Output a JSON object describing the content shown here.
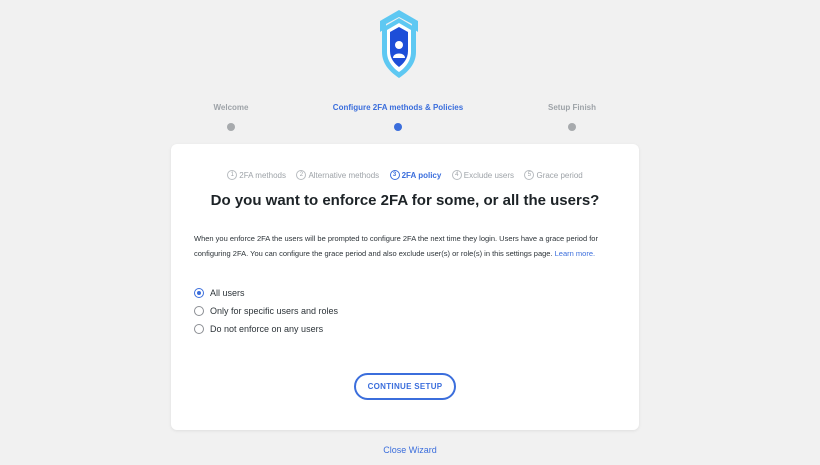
{
  "colors": {
    "accent": "#3b6edc",
    "muted": "#9ea3a8",
    "background": "#f1f1f1"
  },
  "logo": {
    "icon": "shield-lock-icon"
  },
  "stepper": [
    {
      "label": "Welcome",
      "active": false
    },
    {
      "label": "Configure 2FA methods & Policies",
      "active": true
    },
    {
      "label": "Setup Finish",
      "active": false
    }
  ],
  "substeps": [
    {
      "num": "1",
      "label": "2FA methods",
      "active": false
    },
    {
      "num": "2",
      "label": "Alternative methods",
      "active": false
    },
    {
      "num": "3",
      "label": "2FA policy",
      "active": true
    },
    {
      "num": "4",
      "label": "Exclude users",
      "active": false
    },
    {
      "num": "5",
      "label": "Grace period",
      "active": false
    }
  ],
  "question": "Do you want to enforce 2FA for some, or all the users?",
  "description": {
    "text": "When you enforce 2FA the users will be prompted to configure 2FA the next time they login. Users have a grace period for configuring 2FA. You can configure the grace period and also exclude user(s) or role(s) in this settings page.",
    "link": "Learn more."
  },
  "options": [
    {
      "label": "All users",
      "checked": true
    },
    {
      "label": "Only for specific users and roles",
      "checked": false
    },
    {
      "label": "Do not enforce on any users",
      "checked": false
    }
  ],
  "continue_label": "CONTINUE SETUP",
  "close_label": "Close Wizard"
}
